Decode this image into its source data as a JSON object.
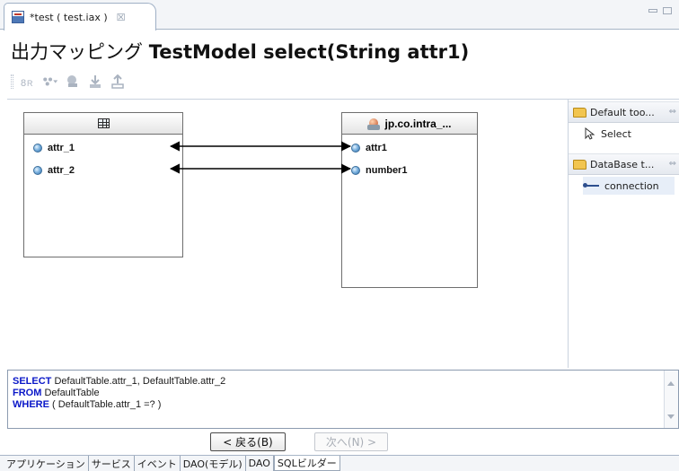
{
  "editor_tab": {
    "title": "*test ( test.iax )",
    "close_glyph": "☒"
  },
  "page_title": {
    "prefix": "出力マッピング ",
    "bold": "TestModel select(String attr1)"
  },
  "left_table": {
    "icon": "table-icon",
    "rows": [
      "attr_1",
      "attr_2"
    ]
  },
  "right_model": {
    "header": "jp.co.intra_...",
    "icon": "model-icon",
    "rows": [
      "attr1",
      "number1"
    ]
  },
  "mappings": [
    {
      "from": "attr_1",
      "to": "attr1"
    },
    {
      "from": "attr_2",
      "to": "number1"
    }
  ],
  "palette": {
    "drawers": [
      {
        "label": "Default too...",
        "tools": [
          {
            "label": "Select",
            "icon": "pointer-icon"
          }
        ]
      },
      {
        "label": "DataBase t...",
        "tools": [
          {
            "label": "connection",
            "icon": "connection-icon",
            "selected": true
          }
        ]
      }
    ],
    "pin_glyph": "⇔"
  },
  "sql": {
    "select_kw": "SELECT",
    "select_body": " DefaultTable.attr_1, DefaultTable.attr_2",
    "from_kw": "FROM",
    "from_body": " DefaultTable",
    "where_kw": "WHERE",
    "where_body": " ( DefaultTable.attr_1 =? )"
  },
  "nav": {
    "back_label": "< 戻る(B)",
    "next_label": "次へ(N) >"
  },
  "bottom_tabs": [
    "アプリケーション",
    "サービス",
    "イベント",
    "DAO(モデル)",
    "DAO",
    "SQLビルダー"
  ],
  "active_bottom_tab": "SQLビルダー",
  "colors": {
    "sql_keyword": "#0a17c8",
    "connector": "#000000",
    "selected_tool_bg": "#e7eef8"
  }
}
